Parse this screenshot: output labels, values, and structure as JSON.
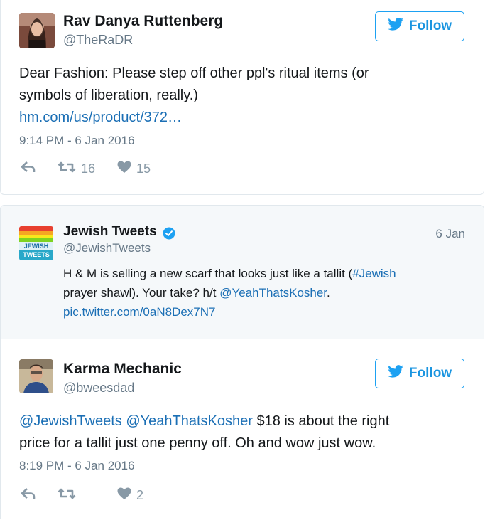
{
  "tweet1": {
    "author_name": "Rav Danya Ruttenberg",
    "author_handle": "@TheRaDR",
    "follow_label": "Follow",
    "text_line1": "Dear Fashion: Please step off other ppl's ritual items (or",
    "text_line2": "symbols of liberation, really.)",
    "link": "hm.com/us/product/372…",
    "timestamp": "9:14 PM - 6 Jan 2016",
    "retweet_count": "16",
    "like_count": "15"
  },
  "quoted_tweet": {
    "author_name": "Jewish Tweets",
    "author_handle": "@JewishTweets",
    "date": "6 Jan",
    "avatar_text_top": "JEWISH",
    "avatar_text_bottom": "TWEETS",
    "text_part1": "H & M is selling a new scarf that looks just like a tallit (",
    "hashtag": "#Jewish",
    "text_part2": "prayer shawl). Your take? h/t ",
    "mention": "@YeahThatsKosher",
    "text_part3": ".",
    "pic_link": "pic.twitter.com/0aN8Dex7N7"
  },
  "tweet2": {
    "author_name": "Karma Mechanic",
    "author_handle": "@bweesdad",
    "follow_label": "Follow",
    "mention1": "@JewishTweets",
    "mention2": "@YeahThatsKosher",
    "text_rest": " $18 is about the right",
    "text_line2": "price for a tallit just one penny off.  Oh and wow just wow.",
    "timestamp": "8:19 PM - 6 Jan 2016",
    "retweet_count": "",
    "like_count": "2"
  },
  "colors": {
    "link": "#1b6fb5",
    "twitter_blue": "#1da1f2",
    "muted": "#657786",
    "icon": "#8899a6"
  },
  "icons": [
    "twitter-bird-icon",
    "reply-icon",
    "retweet-icon",
    "heart-icon",
    "verified-badge-icon"
  ]
}
